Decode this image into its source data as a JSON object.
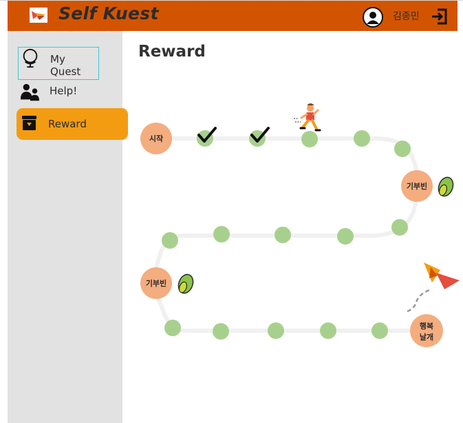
{
  "app": {
    "name": "Self Kuest",
    "user_name": "김종민"
  },
  "header": {
    "logo_icon": "butterfly-logo-icon",
    "avatar_icon": "user-avatar-icon",
    "logout_icon": "logout-icon",
    "background_color": "#d35400"
  },
  "sidebar": {
    "items": [
      {
        "label": "My Quest",
        "icon": "globe-icon",
        "active": false
      },
      {
        "label": "Help!",
        "icon": "people-icon",
        "active": false
      },
      {
        "label": "Reward",
        "icon": "archive-box-icon",
        "active": true
      }
    ],
    "active_color": "#f39c12"
  },
  "main": {
    "title": "Reward"
  },
  "reward_map": {
    "start_label": "시작",
    "donation_label": "기부빈",
    "finish_label": "행복\n날개",
    "finish_lines": [
      "행복",
      "날개"
    ],
    "completed_steps": 2,
    "node_color": "#f4ad7f",
    "step_color": "#a8d08d",
    "runner_icon": "runner-icon",
    "bean_icon": "bean-icon",
    "butterfly_icon": "butterfly-goal-icon",
    "check_icon": "check-icon"
  }
}
